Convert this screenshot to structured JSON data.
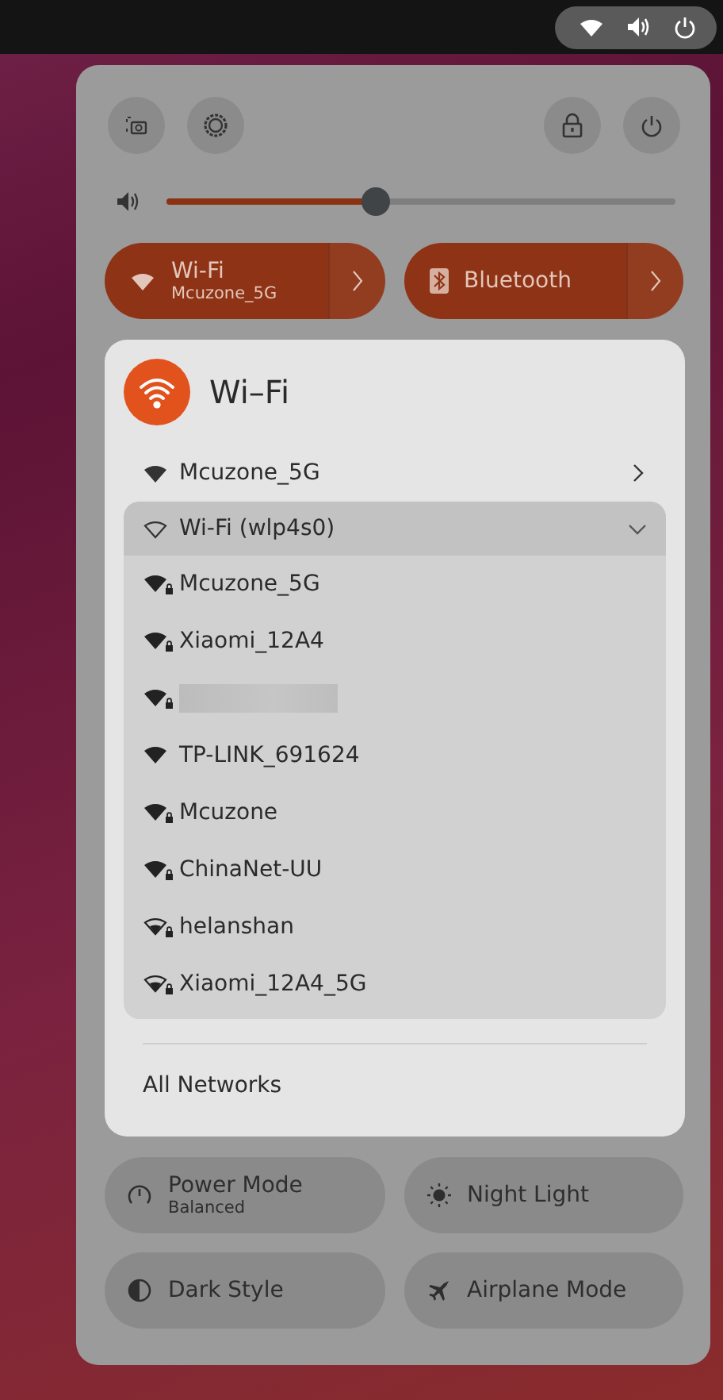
{
  "volume": {
    "level": 0.41
  },
  "menu_toggles": [
    {
      "kind": "wifi",
      "title": "Wi-Fi",
      "subtitle": "Mcuzone_5G",
      "on": true
    },
    {
      "kind": "bluetooth",
      "title": "Bluetooth",
      "on": true
    }
  ],
  "wifi_menu": {
    "title": "Wi–Fi",
    "active_network": "Mcuzone_5G",
    "device": {
      "name": "Wi-Fi (wlp4s0)",
      "expanded": true
    },
    "networks": [
      {
        "name": "Mcuzone_5G",
        "kind": "strong",
        "secured": true
      },
      {
        "name": "Xiaomi_12A4",
        "kind": "strong",
        "secured": true
      },
      {
        "redacted": true,
        "kind": "strong",
        "secured": true
      },
      {
        "name": "TP-LINK_691624",
        "kind": "strong",
        "secured": false
      },
      {
        "name": "Mcuzone",
        "kind": "strong",
        "secured": true
      },
      {
        "name": "ChinaNet-UU",
        "kind": "strong",
        "secured": true
      },
      {
        "name": "helanshan",
        "kind": "weak",
        "secured": true
      },
      {
        "name": "Xiaomi_12A4_5G",
        "kind": "weak",
        "secured": true
      }
    ],
    "footer": "All Networks"
  },
  "toggles": [
    {
      "kind": "power",
      "title": "Power Mode",
      "subtitle": "Balanced",
      "on": false
    },
    {
      "kind": "night",
      "title": "Night Light",
      "on": false
    },
    {
      "kind": "dark",
      "title": "Dark Style",
      "on": false
    },
    {
      "kind": "airplane",
      "title": "Airplane Mode",
      "on": false
    }
  ]
}
